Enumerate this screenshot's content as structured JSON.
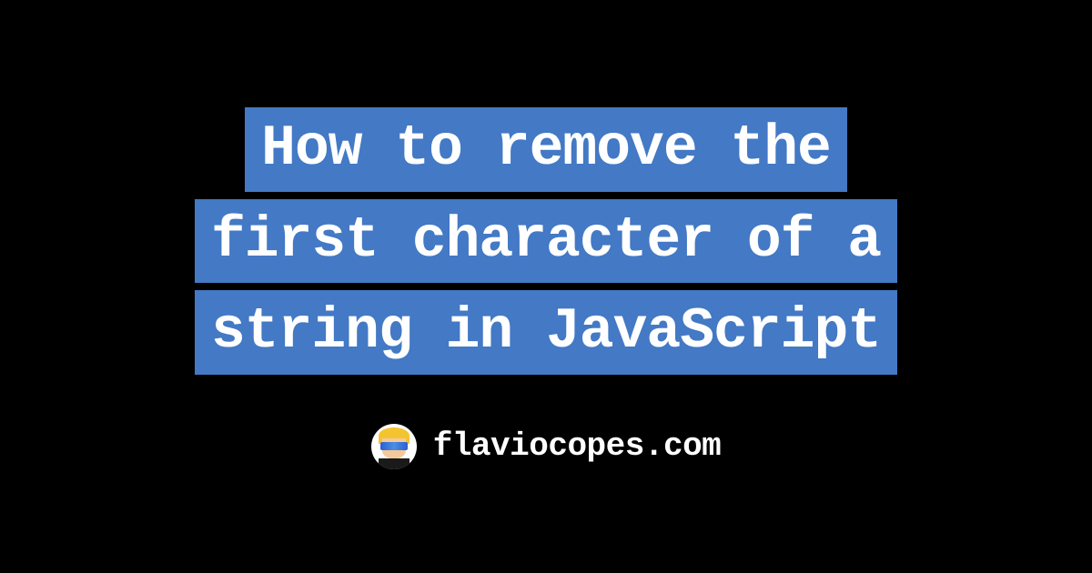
{
  "title": {
    "line1": "How to remove the",
    "line2": "first character of a",
    "line3": "string in JavaScript"
  },
  "footer": {
    "siteName": "flaviocopes.com"
  },
  "colors": {
    "background": "#000000",
    "highlight": "#4379c5",
    "text": "#ffffff"
  }
}
